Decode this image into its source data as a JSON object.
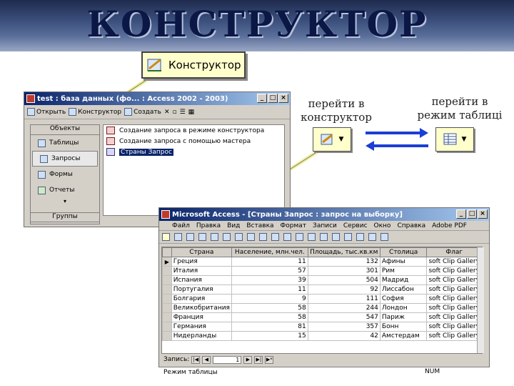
{
  "slide": {
    "title": "КОНСТРУКТОР",
    "big_button_label": "Конструктор",
    "caption_left_line1": "перейти в",
    "caption_left_line2": "конструктор",
    "caption_right_line1": "перейти в",
    "caption_right_line2": "режим таблиці"
  },
  "colors": {
    "banner_text": "#0b1846",
    "callout_bg": "#ffffcc",
    "arrow_blue": "#1a3fd6",
    "title_bar": "#0a246a"
  },
  "db_window": {
    "title": "test : база данных (фо... : Access 2002 - 2003)",
    "toolbar": {
      "open": "Открыть",
      "design": "Конструктор",
      "create": "Создать"
    },
    "nav_header": "Объекты",
    "nav_items": [
      {
        "label": "Таблицы",
        "icon": "table-icon"
      },
      {
        "label": "Запросы",
        "icon": "query-icon"
      },
      {
        "label": "Формы",
        "icon": "form-icon"
      },
      {
        "label": "Отчеты",
        "icon": "report-icon"
      }
    ],
    "nav_footer": "Группы",
    "list_items": [
      "Создание запроса в режиме конструктора",
      "Создание запроса с помощью мастера",
      "Страны Запрос"
    ]
  },
  "table_window": {
    "title": "Microsoft Access - [Страны Запрос : запрос на выборку]",
    "menu": [
      "Файл",
      "Правка",
      "Вид",
      "Вставка",
      "Формат",
      "Записи",
      "Сервис",
      "Окно",
      "Справка",
      "Adobe PDF"
    ],
    "columns": [
      "Страна",
      "Население, млн.чел.",
      "Площадь, тыс.кв.км",
      "Столица",
      "Флаг"
    ],
    "rows": [
      [
        "Греция",
        "11",
        "132",
        "Афины",
        "soft Clip Gallery"
      ],
      [
        "Италия",
        "57",
        "301",
        "Рим",
        "soft Clip Gallery"
      ],
      [
        "Испания",
        "39",
        "504",
        "Мадрид",
        "soft Clip Gallery"
      ],
      [
        "Португалия",
        "11",
        "92",
        "Лиссабон",
        "soft Clip Gallery"
      ],
      [
        "Болгария",
        "9",
        "111",
        "София",
        "soft Clip Gallery"
      ],
      [
        "Великобритания",
        "58",
        "244",
        "Лондон",
        "soft Clip Gallery"
      ],
      [
        "Франция",
        "58",
        "547",
        "Париж",
        "soft Clip Gallery"
      ],
      [
        "Германия",
        "81",
        "357",
        "Бонн",
        "soft Clip Gallery"
      ],
      [
        "Нидерланды",
        "15",
        "42",
        "Амстердам",
        "soft Clip Gallery"
      ]
    ],
    "record_label": "Запись:",
    "record_value": "1",
    "status_text": "Режим таблицы",
    "status_num": "NUM"
  }
}
